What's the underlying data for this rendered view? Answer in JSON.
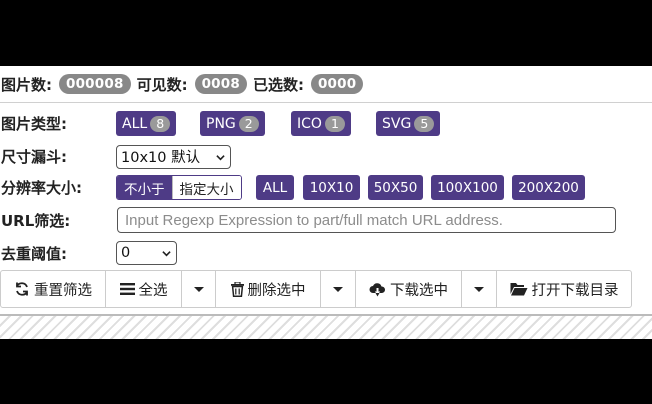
{
  "stats": {
    "images_label": "图片数:",
    "images_value": "000008",
    "visible_label": "可见数:",
    "visible_value": "0008",
    "selected_label": "已选数:",
    "selected_value": "0000"
  },
  "filters": {
    "type_label": "图片类型:",
    "types": [
      {
        "label": "ALL",
        "count": "8"
      },
      {
        "label": "PNG",
        "count": "2"
      },
      {
        "label": "ICO",
        "count": "1"
      },
      {
        "label": "SVG",
        "count": "5"
      }
    ],
    "funnel_label": "尺寸漏斗:",
    "funnel_value": "10x10 默认",
    "resolution_label": "分辨率大小:",
    "resolution_mode_on": "不小于",
    "resolution_mode_off": "指定大小",
    "resolutions": [
      "ALL",
      "10X10",
      "50X50",
      "100X100",
      "200X200"
    ],
    "url_label": "URL筛选:",
    "url_placeholder": "Input Regexp Expression to part/full match URL address.",
    "dedup_label": "去重阈值:",
    "dedup_value": "0"
  },
  "toolbar": {
    "reset": "重置筛选",
    "select_all": "全选",
    "delete_selected": "删除选中",
    "download_selected": "下载选中",
    "open_download_dir": "打开下载目录"
  },
  "colors": {
    "accent": "#4e3b86",
    "pill_gray": "#888888"
  }
}
